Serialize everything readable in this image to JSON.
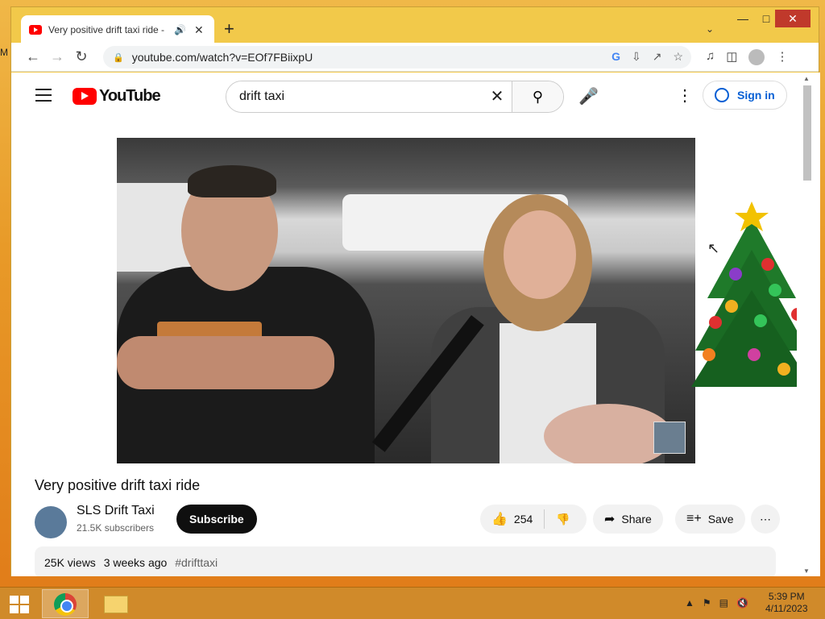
{
  "browser": {
    "tab_title": "Very positive drift taxi ride -",
    "url": "youtube.com/watch?v=EOf7FBiixpU"
  },
  "youtube": {
    "logo_text": "YouTube",
    "search_value": "drift taxi",
    "signin_label": "Sign in",
    "video_title": "Very positive drift taxi ride",
    "channel_name": "SLS Drift Taxi",
    "subscribers": "21.5K subscribers",
    "subscribe_label": "Subscribe",
    "likes": "254",
    "share_label": "Share",
    "save_label": "Save",
    "views": "25K views",
    "posted": "3 weeks ago",
    "hashtag": "#drifttaxi"
  },
  "desktop": {
    "clock_time": "5:39 PM",
    "clock_date": "4/11/2023"
  }
}
